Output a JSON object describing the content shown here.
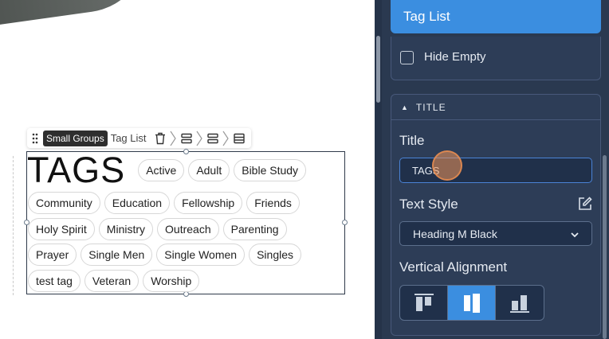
{
  "canvas": {
    "toolbar": {
      "breadcrumb_active": "Small Groups",
      "breadcrumb": "Tag List"
    },
    "widget": {
      "title": "TAGS",
      "tag_rows": [
        [
          "Active",
          "Adult",
          "Bible Study"
        ],
        [
          "Community",
          "Education",
          "Fellowship",
          "Friends"
        ],
        [
          "Holy Spirit",
          "Ministry",
          "Outreach",
          "Parenting"
        ],
        [
          "Prayer",
          "Single Men",
          "Single Women",
          "Singles"
        ],
        [
          "test tag",
          "Veteran",
          "Worship"
        ]
      ]
    }
  },
  "panel": {
    "tag_list_button": "Tag List",
    "hide_empty_label": "Hide Empty",
    "hide_empty_checked": false,
    "title_section_header": "TITLE",
    "title_label": "Title",
    "title_value": "TAGS",
    "text_style_label": "Text Style",
    "text_style_value": "Heading M Black",
    "vertical_alignment_label": "Vertical Alignment",
    "vertical_alignment_selected": "center",
    "accent_color": "#3b8ee0"
  }
}
